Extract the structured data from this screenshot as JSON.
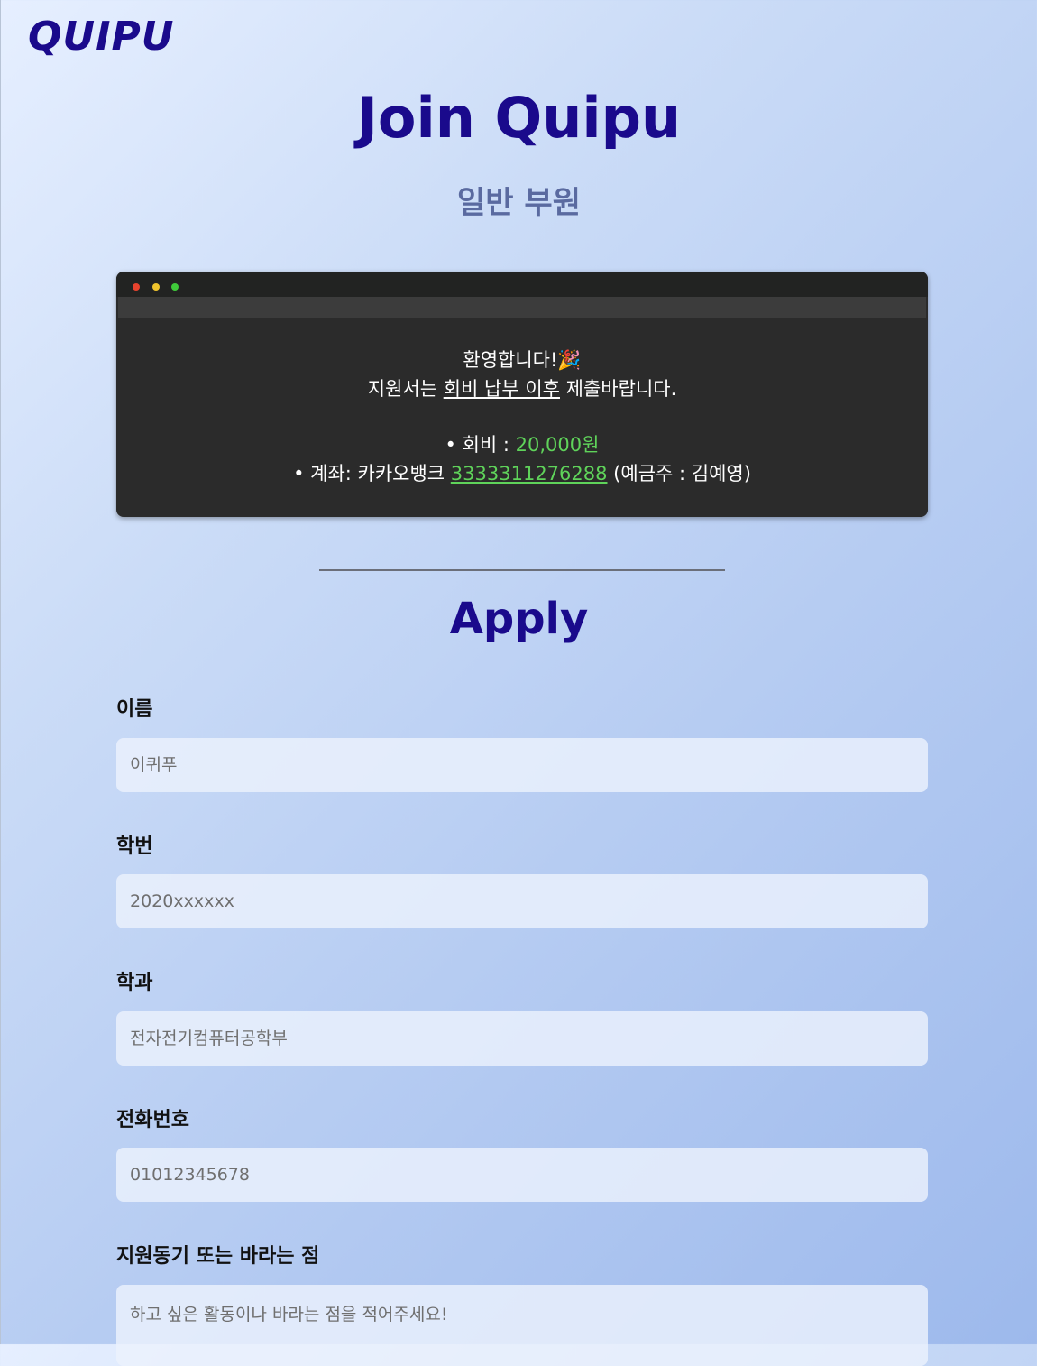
{
  "header": {
    "logo": "QUIPU",
    "title": "Join Quipu",
    "subtitle": "일반 부원"
  },
  "notice": {
    "welcome": "환영합니다!🎉",
    "line2_prefix": "지원서는 ",
    "line2_emphasis": "회비 납부 이후",
    "line2_suffix": " 제출바랍니다.",
    "fee_label": "• 회비 : ",
    "fee_value": "20,000원",
    "account_label": "• 계좌: 카카오뱅크 ",
    "account_number": "3333311276288",
    "account_holder": " (예금주 : 김예영)"
  },
  "form": {
    "title": "Apply",
    "fields": [
      {
        "label": "이름",
        "placeholder": "이퀴푸"
      },
      {
        "label": "학번",
        "placeholder": "2020xxxxxx"
      },
      {
        "label": "학과",
        "placeholder": "전자전기컴퓨터공학부"
      },
      {
        "label": "전화번호",
        "placeholder": "01012345678"
      },
      {
        "label": "지원동기 또는 바라는 점",
        "placeholder": "하고 싶은 활동이나 바라는 점을 적어주세요!"
      }
    ]
  }
}
